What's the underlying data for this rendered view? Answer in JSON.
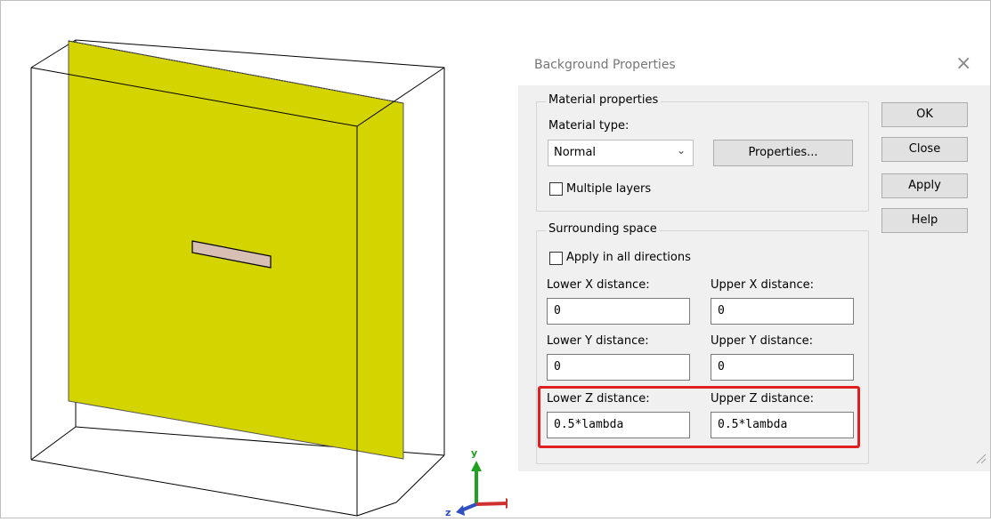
{
  "dialog": {
    "title": "Background Properties",
    "material": {
      "group_label": "Material properties",
      "type_label": "Material type:",
      "type_value": "Normal",
      "properties_button": "Properties...",
      "multiple_layers_label": "Multiple layers",
      "multiple_layers_checked": false
    },
    "surrounding": {
      "group_label": "Surrounding space",
      "apply_all_label": "Apply in all directions",
      "apply_all_checked": false,
      "lower_x_label": "Lower X distance:",
      "upper_x_label": "Upper X distance:",
      "lower_x_value": "0",
      "upper_x_value": "0",
      "lower_y_label": "Lower Y distance:",
      "upper_y_label": "Upper Y distance:",
      "lower_y_value": "0",
      "upper_y_value": "0",
      "lower_z_label": "Lower Z distance:",
      "upper_z_label": "Upper Z distance:",
      "lower_z_value": "0.5*lambda",
      "upper_z_value": "0.5*lambda"
    },
    "buttons": {
      "ok": "OK",
      "close": "Close",
      "apply": "Apply",
      "help": "Help"
    }
  },
  "axes": {
    "x": "x",
    "y": "y",
    "z": "z"
  },
  "colors": {
    "plane": "#d4d400",
    "slot": "#d8bfb4",
    "highlight": "#e02020",
    "axis_x": "#d03030",
    "axis_y": "#20a020",
    "axis_z": "#3050c0"
  }
}
